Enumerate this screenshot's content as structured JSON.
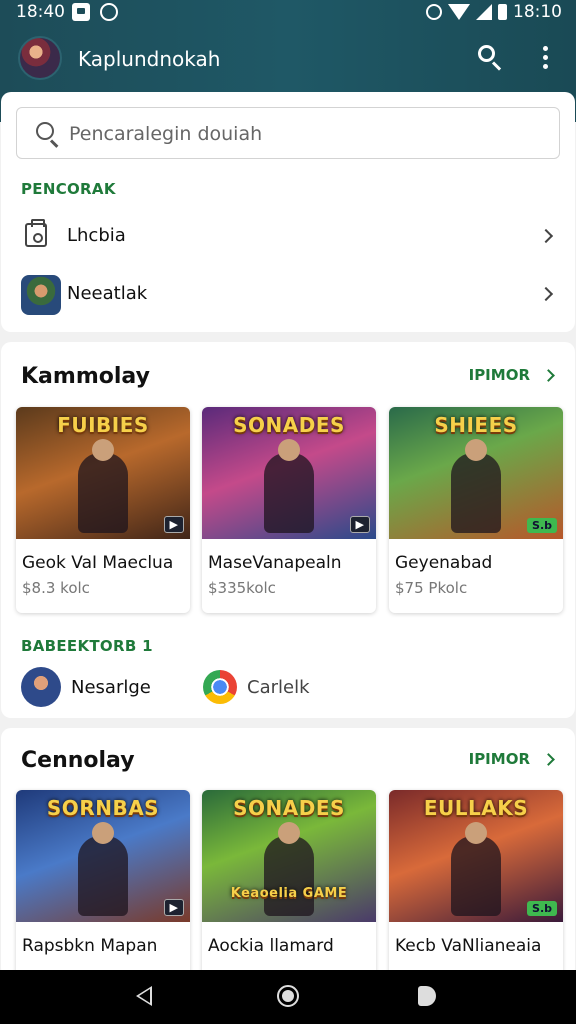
{
  "status_bar": {
    "time_left": "18:40",
    "time_right": "18:10"
  },
  "app_bar": {
    "title": "Kaplundnokah"
  },
  "search": {
    "placeholder": "Pencaralegin douiah"
  },
  "recent": {
    "label": "PENCORAK",
    "items": [
      {
        "label": "Lhcbia",
        "icon": "clipboard-icon"
      },
      {
        "label": "Neeatlak",
        "icon": "game-thumbnail"
      }
    ]
  },
  "section1": {
    "title": "Kammolay",
    "more_label": "IPIMOR",
    "games": [
      {
        "art_title": "FUIBIES",
        "name": "Geok VaI Maeclua",
        "price": "$8.3 kolc",
        "badge": ""
      },
      {
        "art_title": "SONADES",
        "name": "MaseVanapealn",
        "price": "$335kolc",
        "badge": ""
      },
      {
        "art_title": "SHIEES",
        "name": "Geyenabad",
        "price": "$75 Pkolc",
        "badge": "S.b"
      }
    ],
    "friends_label": "BABEEKTORB 1",
    "friends": [
      {
        "name": "Nesarlge",
        "icon": "person-avatar"
      },
      {
        "name": "Carlelk",
        "icon": "chrome-icon"
      }
    ]
  },
  "section2": {
    "title": "Cennolay",
    "more_label": "IPIMOR",
    "games": [
      {
        "art_title": "SORNBAS",
        "name": "Rapsbkn Mapan",
        "price": "",
        "badge": ""
      },
      {
        "art_title": "SONADES",
        "name": "Aockia llamard",
        "price": "",
        "badge": "",
        "sub_title": "Keaoelia GAME"
      },
      {
        "art_title": "EULLAKS",
        "name": "Kecb VaNlianeaia",
        "price": "",
        "badge": "S.b"
      }
    ]
  },
  "colors": {
    "topbar": "#1f5866",
    "accent_green": "#1f7a3a"
  }
}
